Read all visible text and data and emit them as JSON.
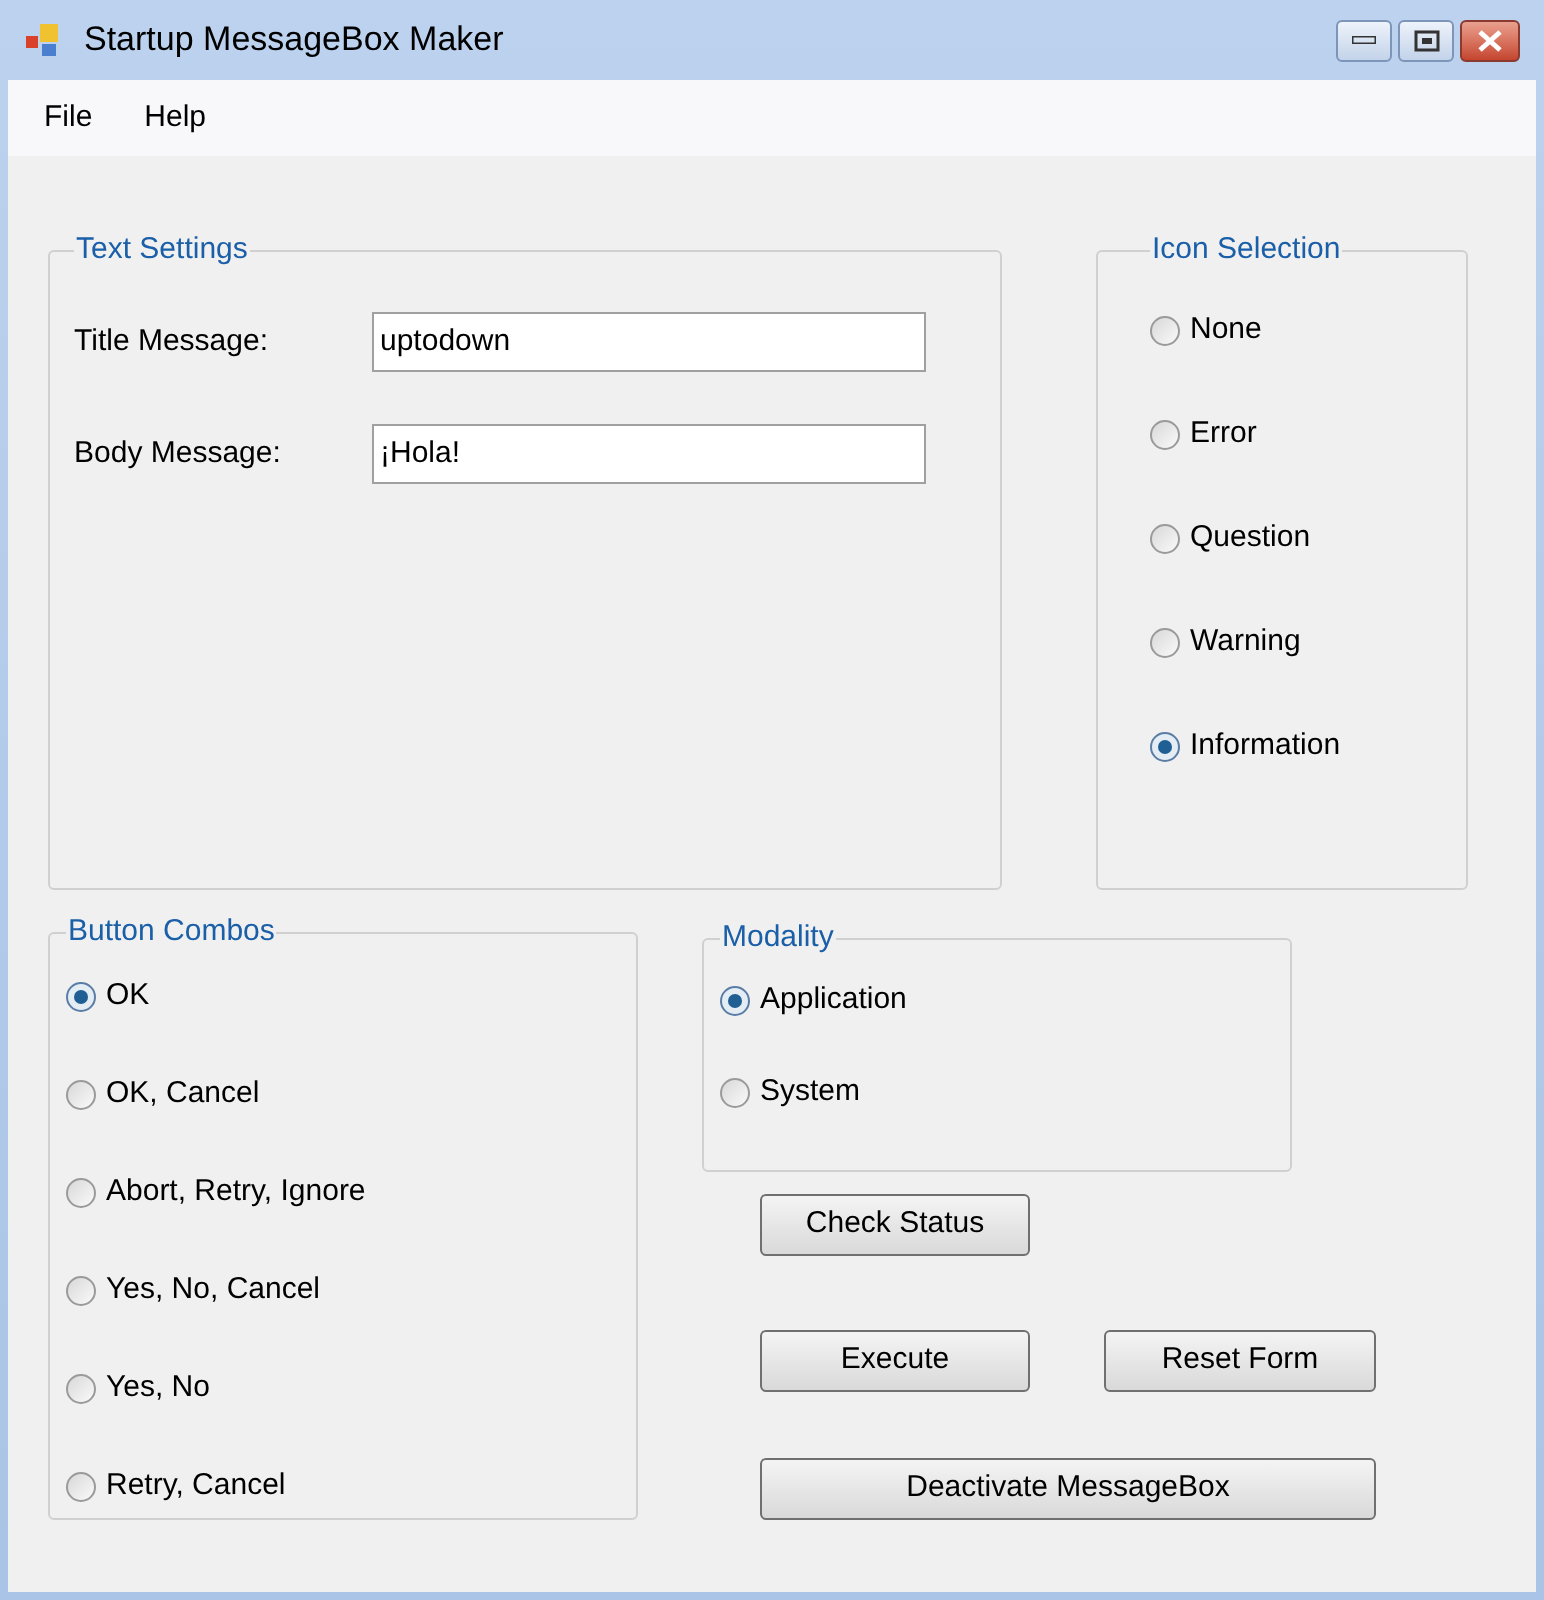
{
  "window": {
    "title": "Startup MessageBox Maker"
  },
  "menu": [
    "File",
    "Help"
  ],
  "text_settings": {
    "title": "Text Settings",
    "fields": [
      {
        "label": "Title Message:",
        "value": "uptodown"
      },
      {
        "label": "Body Message:",
        "value": "¡Hola!"
      }
    ]
  },
  "icon_selection": {
    "title": "Icon Selection",
    "options": [
      {
        "label": "None",
        "selected": false
      },
      {
        "label": "Error",
        "selected": false
      },
      {
        "label": "Question",
        "selected": false
      },
      {
        "label": "Warning",
        "selected": false
      },
      {
        "label": "Information",
        "selected": true
      }
    ]
  },
  "button_combos": {
    "title": "Button Combos",
    "options": [
      {
        "label": "OK",
        "selected": true
      },
      {
        "label": "OK, Cancel",
        "selected": false
      },
      {
        "label": "Abort, Retry, Ignore",
        "selected": false
      },
      {
        "label": "Yes, No, Cancel",
        "selected": false
      },
      {
        "label": "Yes, No",
        "selected": false
      },
      {
        "label": "Retry, Cancel",
        "selected": false
      }
    ]
  },
  "modality": {
    "title": "Modality",
    "options": [
      {
        "label": "Application",
        "selected": true
      },
      {
        "label": "System",
        "selected": false
      }
    ]
  },
  "buttons": [
    "Check Status",
    "Execute",
    "Reset Form",
    "Deactivate MessageBox"
  ]
}
